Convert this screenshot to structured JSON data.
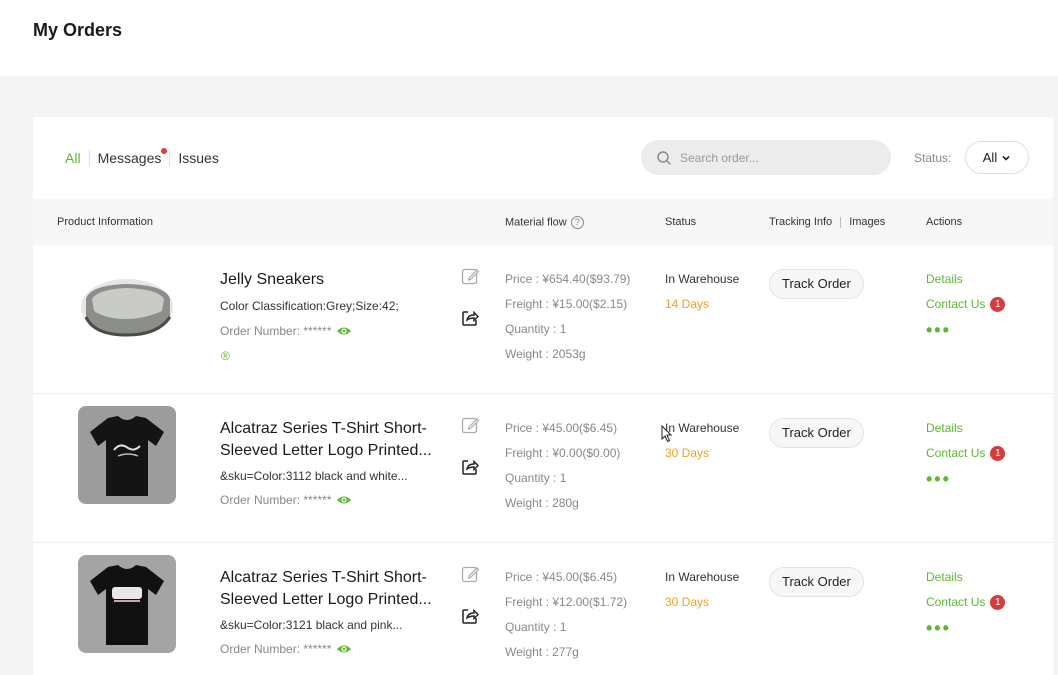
{
  "page": {
    "title": "My Orders"
  },
  "filters": {
    "tabs": [
      {
        "label": "All",
        "active": true
      },
      {
        "label": "Messages",
        "has_dot": true
      },
      {
        "label": "Issues"
      }
    ],
    "search_placeholder": "Search order...",
    "status_label": "Status:",
    "status_value": "All"
  },
  "table": {
    "headers": {
      "product": "Product Information",
      "material": "Material flow",
      "status": "Status",
      "tracking": "Tracking Info",
      "images": "Images",
      "actions": "Actions"
    }
  },
  "orders": [
    {
      "title": "Jelly Sneakers",
      "sku": "Color Classification:Grey;Size:42;",
      "order_number_label": "Order Number:",
      "order_number": "******",
      "extra_mark": "®",
      "price": "Price : ¥654.40($93.79)",
      "freight": "Freight : ¥15.00($2.15)",
      "quantity": "Quantity : 1",
      "weight": "Weight : 2053g",
      "status": "In Warehouse",
      "days": "14 Days",
      "track_label": "Track Order",
      "details_label": "Details",
      "contact_label": "Contact Us",
      "contact_badge": "1",
      "more_label": "•••"
    },
    {
      "title": "Alcatraz Series T-Shirt Short-Sleeved Letter Logo Printed...",
      "sku": "&sku=Color:3112 black and white...",
      "order_number_label": "Order Number:",
      "order_number": "******",
      "price": "Price : ¥45.00($6.45)",
      "freight": "Freight : ¥0.00($0.00)",
      "quantity": "Quantity : 1",
      "weight": "Weight : 280g",
      "status": "In Warehouse",
      "days": "30 Days",
      "track_label": "Track Order",
      "details_label": "Details",
      "contact_label": "Contact Us",
      "contact_badge": "1",
      "more_label": "•••"
    },
    {
      "title": "Alcatraz Series T-Shirt Short-Sleeved Letter Logo Printed...",
      "sku": "&sku=Color:3121 black and pink...",
      "order_number_label": "Order Number:",
      "order_number": "******",
      "price": "Price : ¥45.00($6.45)",
      "freight": "Freight : ¥12.00($1.72)",
      "quantity": "Quantity : 1",
      "weight": "Weight : 277g",
      "status": "In Warehouse",
      "days": "30 Days",
      "track_label": "Track Order",
      "details_label": "Details",
      "contact_label": "Contact Us",
      "contact_badge": "1",
      "more_label": "•••"
    }
  ],
  "colors": {
    "accent": "#5cb82c",
    "warning": "#f0a020",
    "badge": "#d83b3b"
  },
  "icons": [
    "search-icon",
    "chevron-down-icon",
    "help-icon",
    "edit-icon",
    "share-icon",
    "eye-icon",
    "mouse-cursor-icon"
  ]
}
